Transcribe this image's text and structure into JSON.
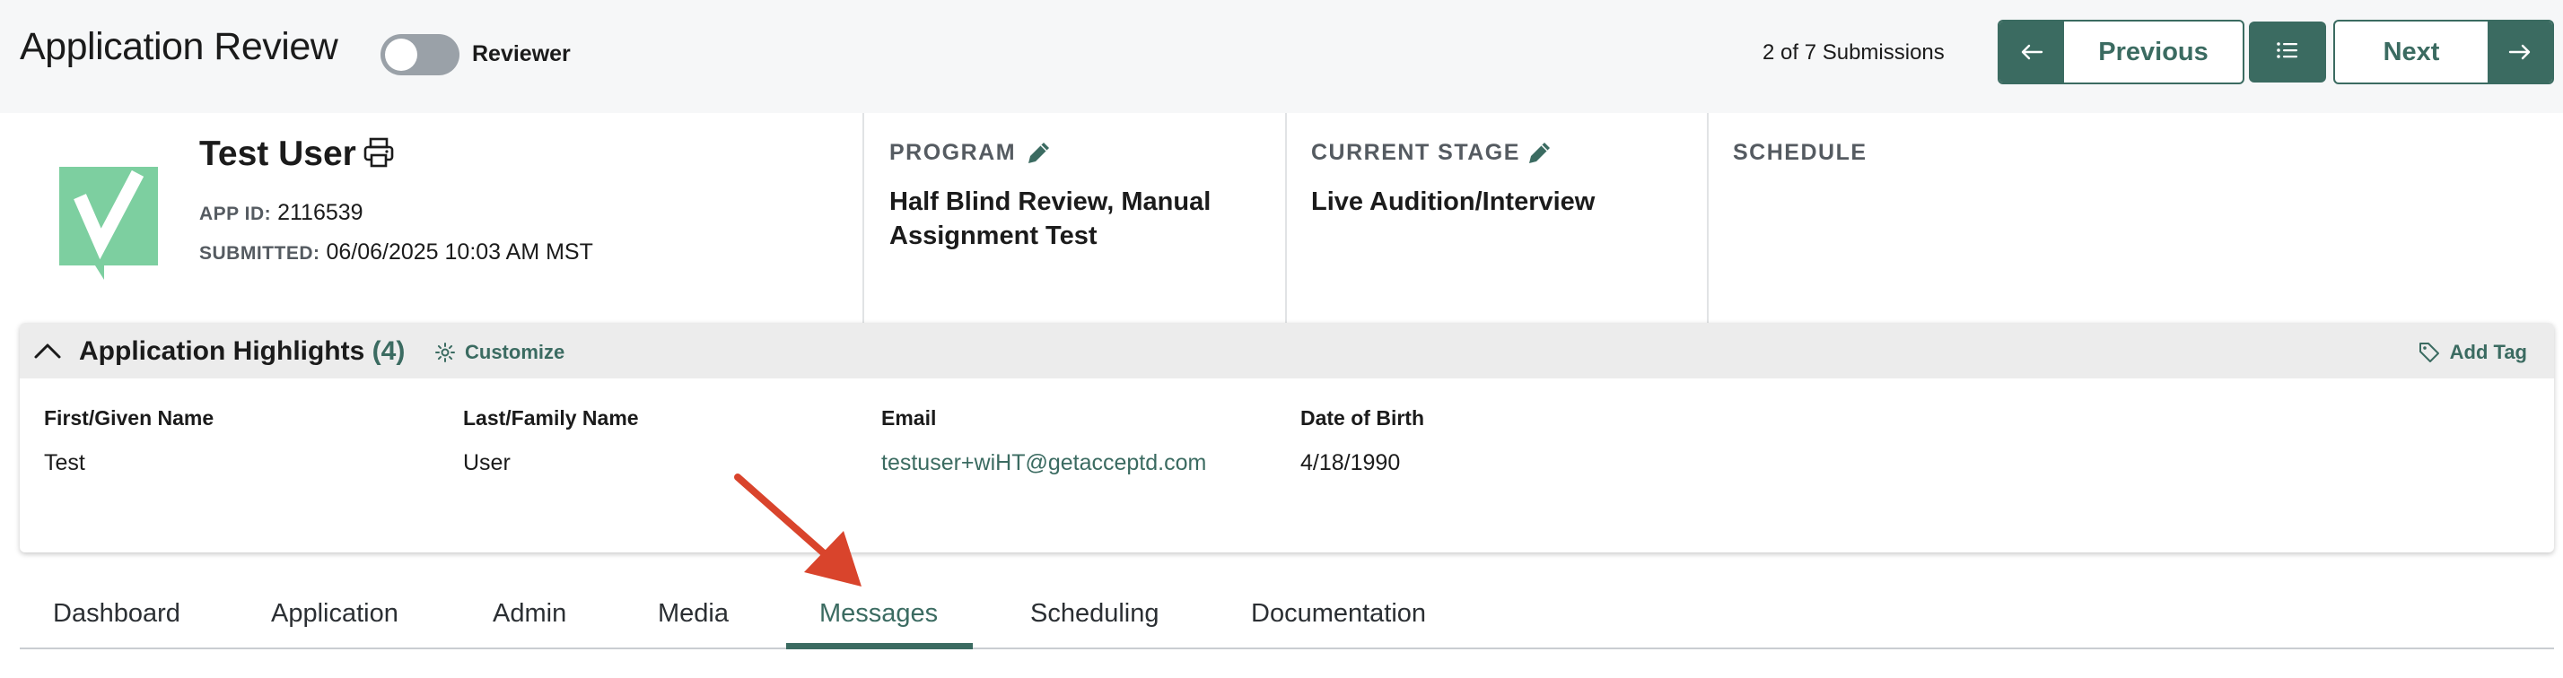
{
  "header": {
    "title": "Application Review",
    "toggle_label": "Reviewer",
    "toggle_on": false,
    "submission_count": "2 of 7 Submissions",
    "previous_label": "Previous",
    "next_label": "Next"
  },
  "applicant": {
    "name": "Test User",
    "app_id_key": "APP ID:",
    "app_id": "2116539",
    "submitted_key": "SUBMITTED:",
    "submitted": "06/06/2025 10:03 AM MST"
  },
  "columns": {
    "program_head": "PROGRAM",
    "program_value_1": "Half Blind Review, Manual",
    "program_value_2": "Assignment Test",
    "stage_head": "CURRENT STAGE",
    "stage_value": "Live Audition/Interview",
    "schedule_head": "SCHEDULE"
  },
  "highlights": {
    "title": "Application Highlights",
    "count": "(4)",
    "customize_label": "Customize",
    "add_tag_label": "Add Tag",
    "fields": [
      {
        "label": "First/Given Name",
        "value": "Test"
      },
      {
        "label": "Last/Family Name",
        "value": "User"
      },
      {
        "label": "Email",
        "value": "testuser+wiHT@getacceptd.com"
      },
      {
        "label": "Date of Birth",
        "value": "4/18/1990"
      }
    ]
  },
  "tabs": [
    {
      "label": "Dashboard"
    },
    {
      "label": "Application"
    },
    {
      "label": "Admin"
    },
    {
      "label": "Media"
    },
    {
      "label": "Messages",
      "active": true
    },
    {
      "label": "Scheduling"
    },
    {
      "label": "Documentation"
    }
  ],
  "colors": {
    "accent": "#3b6b61",
    "logo": "#7dcfa0",
    "annotation_arrow": "#d9442c"
  },
  "icons": [
    "arrow-left-icon",
    "list-icon",
    "arrow-right-icon",
    "printer-icon",
    "pencil-icon",
    "chevron-up-icon",
    "gear-icon",
    "tag-icon",
    "annotation-arrow"
  ]
}
